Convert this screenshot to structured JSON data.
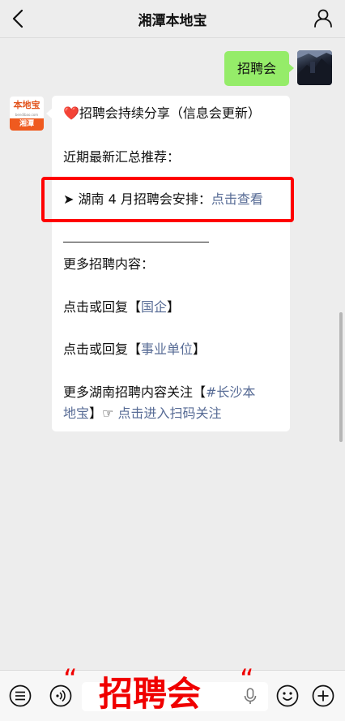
{
  "header": {
    "title": "湘潭本地宝",
    "back_icon": "chevron-left-icon",
    "profile_icon": "person-icon"
  },
  "chat": {
    "outgoing": {
      "text": "招聘会"
    },
    "bot_avatar": {
      "logo_top": "本地宝",
      "logo_url": "bendibao.com",
      "logo_bottom": "湘潭"
    },
    "incoming": {
      "heart": "❤️",
      "line1": "招聘会持续分享（信息会更新）",
      "line2": "近期最新汇总推荐：",
      "line3_prefix": "➤ 湖南 4 月招聘会安排：",
      "line3_link": "点击查看",
      "line4": "更多招聘内容：",
      "line5_prefix": "点击或回复【",
      "line5_link": "国企",
      "line5_suffix": "】",
      "line6_prefix": "点击或回复【",
      "line6_link": "事业单位",
      "line6_suffix": "】",
      "line7_prefix": "更多湖南招聘内容关注【",
      "line7_link": "#长沙本",
      "line8_link": "地宝",
      "line8_mid": "】☞ ",
      "line8_link2": "点击进入扫码关注"
    }
  },
  "input_bar": {
    "caption_open_quote": "“",
    "caption_text": "招聘会",
    "caption_close_quote": "“"
  },
  "colors": {
    "outgoing_bubble": "#95ec69",
    "link": "#576b95",
    "highlight": "#ff0000",
    "caption": "#f00000"
  }
}
